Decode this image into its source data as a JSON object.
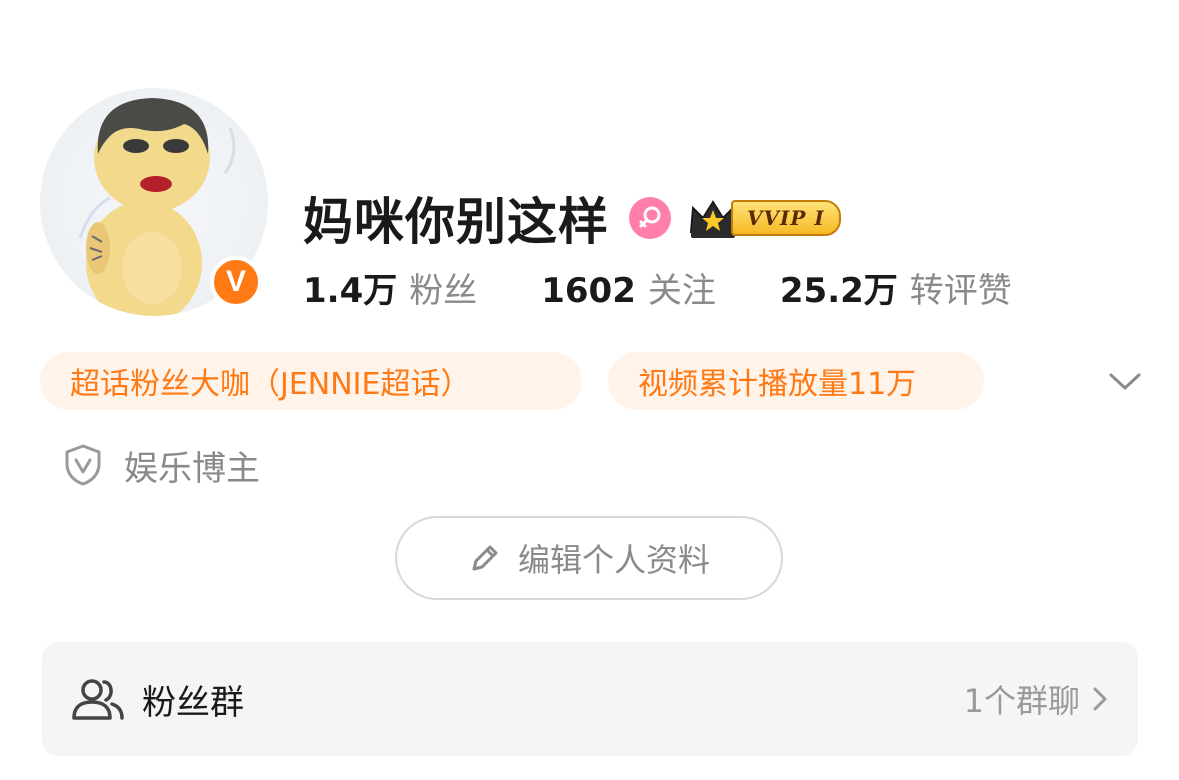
{
  "profile": {
    "username": "妈咪你别这样",
    "verified_badge": "V",
    "vip_label": "VVIP I",
    "colors": {
      "accent": "#ff7a14",
      "gender_pink": "#ff7fa8",
      "tag_bg": "#fff3ea",
      "vip_gold": "#f7b924"
    },
    "icons": {
      "gender": "female-symbol-icon",
      "vip": "crown-icon"
    }
  },
  "stats": [
    {
      "value": "1.4万",
      "label": "粉丝"
    },
    {
      "value": "1602",
      "label": "关注"
    },
    {
      "value": "25.2万",
      "label": "转评赞"
    }
  ],
  "tags": [
    {
      "label": "超话粉丝大咖（JENNIE超话）"
    },
    {
      "label": "视频累计播放量11万"
    }
  ],
  "category": {
    "label": "娱乐博主",
    "icon": "shield-v-icon"
  },
  "edit_button": {
    "label": "编辑个人资料",
    "icon": "pencil-icon"
  },
  "fan_group": {
    "title": "粉丝群",
    "count": "1个群聊",
    "icon": "users-icon"
  }
}
